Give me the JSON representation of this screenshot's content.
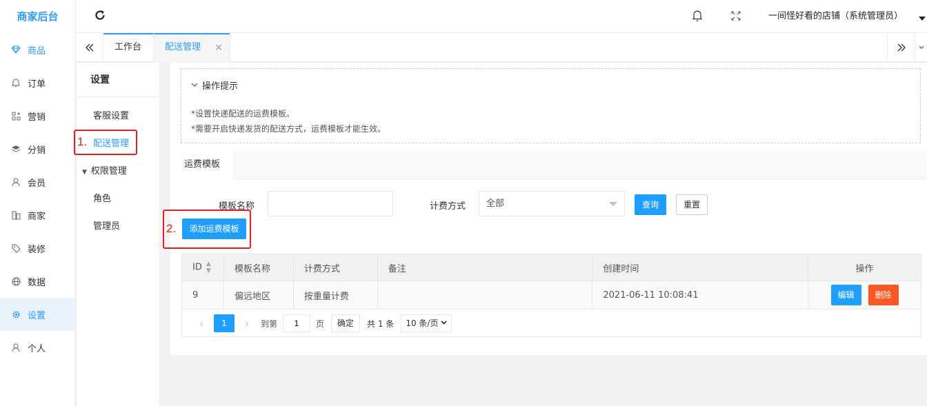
{
  "brand": "商家后台",
  "nav": [
    {
      "label": "商品",
      "icon": "diamond-icon"
    },
    {
      "label": "订单",
      "icon": "bell-icon"
    },
    {
      "label": "营销",
      "icon": "apps-icon"
    },
    {
      "label": "分销",
      "icon": "layers-icon"
    },
    {
      "label": "会员",
      "icon": "user-icon"
    },
    {
      "label": "商家",
      "icon": "store-icon"
    },
    {
      "label": "装修",
      "icon": "tag-icon"
    },
    {
      "label": "数据",
      "icon": "globe-icon"
    },
    {
      "label": "设置",
      "icon": "gear-icon"
    },
    {
      "label": "个人",
      "icon": "person-icon"
    }
  ],
  "header": {
    "user": "一间怪好看的店铺（系统管理员）"
  },
  "tabs": {
    "home": "工作台",
    "active": "配送管理",
    "close": "×"
  },
  "submenu": {
    "title": "设置",
    "items": [
      "客服设置",
      "配送管理",
      "权限管理",
      "角色",
      "管理员"
    ]
  },
  "annotations": {
    "one": "1.",
    "two": "2."
  },
  "tips": {
    "title": "操作提示",
    "line1": "*设置快递配送的运费模板。",
    "line2": "*需要开启快递发货的配送方式，运费模板才能生效。"
  },
  "card": {
    "tab": "运费模板"
  },
  "filters": {
    "name_label": "模板名称",
    "name_value": "",
    "method_label": "计费方式",
    "method_value": "全部",
    "query": "查询",
    "reset": "重置",
    "add": "添加运费模板"
  },
  "table": {
    "headers": [
      "ID",
      "模板名称",
      "计费方式",
      "备注",
      "创建时间",
      "操作"
    ],
    "rows": [
      {
        "id": "9",
        "name": "偏远地区",
        "method": "按重量计费",
        "note": "",
        "created": "2021-06-11 10:08:41",
        "edit": "编辑",
        "delete": "删除"
      }
    ]
  },
  "pager": {
    "prev": "‹",
    "current": "1",
    "next": "›",
    "goto": "到第",
    "page_input": "1",
    "unit": "页",
    "confirm": "确定",
    "total": "共 1 条",
    "size": "10 条/页"
  },
  "colors": {
    "accent": "#1e9fff",
    "brand": "#2f9bf4",
    "danger": "#ff5722",
    "annotation": "#e02020"
  }
}
